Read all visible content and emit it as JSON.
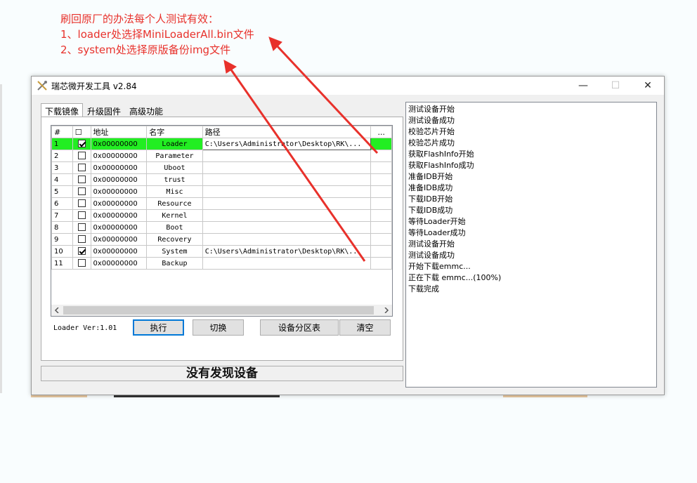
{
  "annotations": [
    "刷回原厂的办法每个人测试有效：",
    "1、loader处选择MiniLoaderAll.bin文件",
    "2、system处选择原版备份img文件"
  ],
  "window": {
    "title": "瑞芯微开发工具 v2.84",
    "controls": {
      "minimize": "—",
      "maximize": "☐",
      "close": "✕"
    }
  },
  "tabs": [
    {
      "label": "下载镜像",
      "active": true
    },
    {
      "label": "升级固件",
      "active": false
    },
    {
      "label": "高级功能",
      "active": false
    }
  ],
  "table": {
    "headers": {
      "num": "#",
      "check": "☐",
      "address": "地址",
      "name": "名字",
      "path": "路径",
      "more": "..."
    },
    "rows": [
      {
        "num": "1",
        "checked": true,
        "address": "0x00000000",
        "name": "Loader",
        "path": "C:\\Users\\Administrator\\Desktop\\RK\\...",
        "selected": true
      },
      {
        "num": "2",
        "checked": false,
        "address": "0x00000000",
        "name": "Parameter",
        "path": ""
      },
      {
        "num": "3",
        "checked": false,
        "address": "0x00000000",
        "name": "Uboot",
        "path": ""
      },
      {
        "num": "4",
        "checked": false,
        "address": "0x00000000",
        "name": "trust",
        "path": ""
      },
      {
        "num": "5",
        "checked": false,
        "address": "0x00000000",
        "name": "Misc",
        "path": ""
      },
      {
        "num": "6",
        "checked": false,
        "address": "0x00000000",
        "name": "Resource",
        "path": ""
      },
      {
        "num": "7",
        "checked": false,
        "address": "0x00000000",
        "name": "Kernel",
        "path": ""
      },
      {
        "num": "8",
        "checked": false,
        "address": "0x00000000",
        "name": "Boot",
        "path": ""
      },
      {
        "num": "9",
        "checked": false,
        "address": "0x00000000",
        "name": "Recovery",
        "path": ""
      },
      {
        "num": "10",
        "checked": true,
        "address": "0x00000000",
        "name": "System",
        "path": "C:\\Users\\Administrator\\Desktop\\RK\\..."
      },
      {
        "num": "11",
        "checked": false,
        "address": "0x00000000",
        "name": "Backup",
        "path": ""
      }
    ]
  },
  "loader_version": "Loader Ver:1.01",
  "buttons": {
    "execute": "执行",
    "switch": "切换",
    "partition_table": "设备分区表",
    "clear": "清空"
  },
  "status": "没有发现设备",
  "log": [
    "测试设备开始",
    "测试设备成功",
    "校验芯片开始",
    "校验芯片成功",
    "获取FlashInfo开始",
    "获取FlashInfo成功",
    "准备IDB开始",
    "准备IDB成功",
    "下载IDB开始",
    "下载IDB成功",
    "等待Loader开始",
    "等待Loader成功",
    "测试设备开始",
    "测试设备成功",
    "开始下载emmc...",
    "正在下载 emmc...(100%)",
    "下载完成"
  ],
  "colors": {
    "annotation": "#e8312b",
    "selected_row": "#22ee22",
    "default_button_border": "#0078d7"
  },
  "icons": {
    "app": "tools-icon",
    "scroll_left": "chevron-left-icon",
    "scroll_right": "chevron-right-icon"
  }
}
